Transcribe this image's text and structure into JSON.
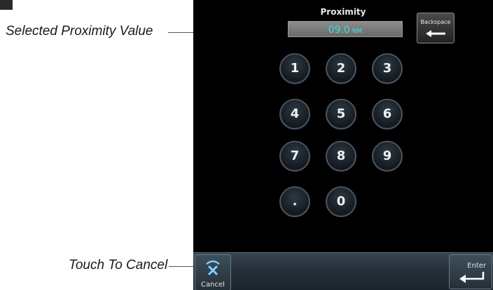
{
  "callouts": {
    "selected_value": "Selected Proximity Value",
    "touch_cancel": "Touch To Cancel"
  },
  "screen": {
    "title": "Proximity",
    "value": {
      "digits": "09.0",
      "unit": "NM"
    },
    "backspace_label": "Backspace",
    "keypad": [
      "1",
      "2",
      "3",
      "4",
      "5",
      "6",
      "7",
      "8",
      "9",
      ".",
      "0"
    ],
    "cancel_label": "Cancel",
    "enter_label": "Enter"
  },
  "icons": {
    "backspace": "left-arrow-icon",
    "cancel": "cancel-x-icon",
    "enter": "enter-return-icon"
  },
  "colors": {
    "value_text": "#3ee0e0",
    "screen_bg": "#000000"
  }
}
